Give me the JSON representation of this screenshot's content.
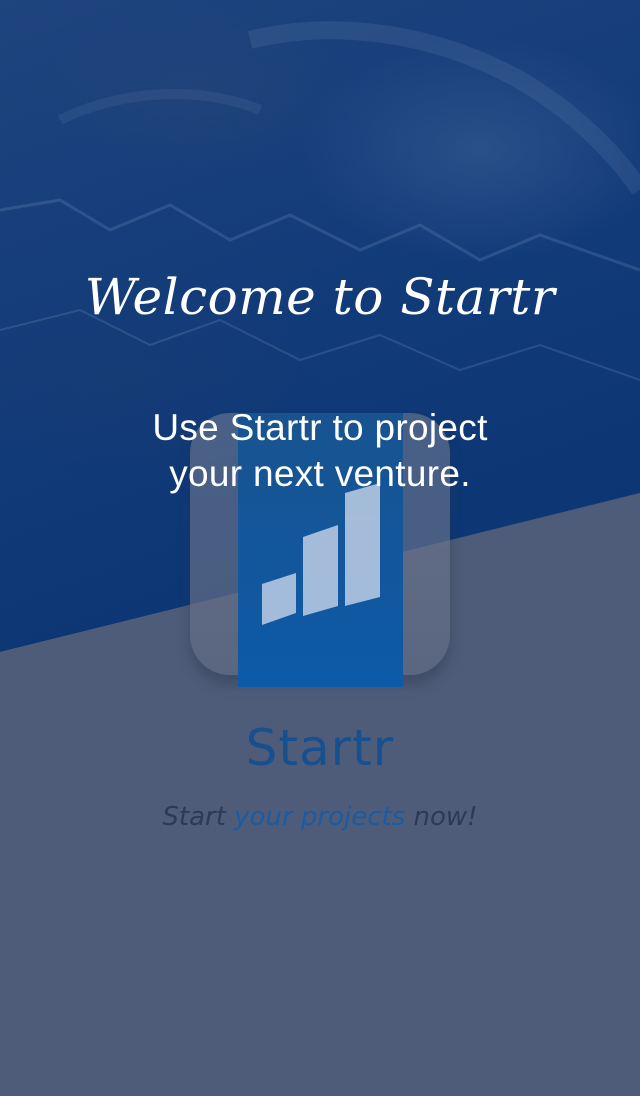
{
  "splash": {
    "welcome_title": "Welcome to Startr",
    "intro_line_1": "Use Startr to project",
    "intro_line_2": "your next venture.",
    "app_name": "Startr",
    "tagline_start": "Start",
    "tagline_highlight": "your projects",
    "tagline_end": "now!"
  },
  "colors": {
    "top_background": "#0f3b78",
    "bottom_background": "#4e5c79",
    "brand_blue": "#17508f",
    "accent_blue": "#1a5ba3",
    "title_text": "#ffffff"
  },
  "icons": {
    "app_icon": "bar-chart-growth-icon"
  }
}
